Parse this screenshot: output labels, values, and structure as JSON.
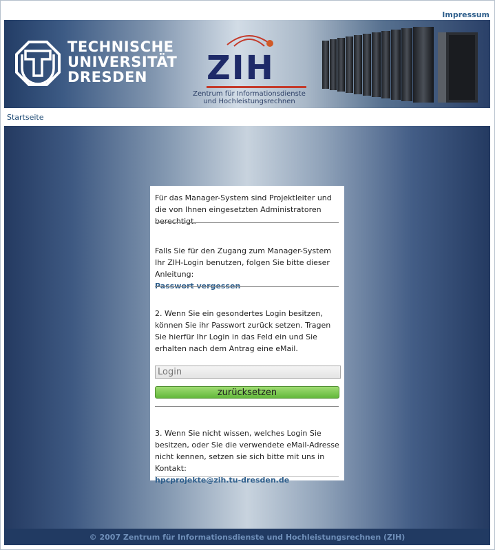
{
  "header": {
    "impressum": "Impressum"
  },
  "banner": {
    "university_lines": [
      "TECHNISCHE",
      "UNIVERSITÄT",
      "DRESDEN"
    ],
    "zih_word": "ZIH",
    "zih_subtitle_lines": [
      "Zentrum für Informationsdienste",
      "und Hochleistungsrechnen"
    ]
  },
  "nav": {
    "startseite": "Startseite"
  },
  "panel": {
    "intro": "Für das Manager-System sind Projektleiter und die von Ihnen eingesetzten Administratoren berechtigt.",
    "section1_text": "Falls Sie für den Zugang zum Manager-System Ihr ZIH-Login benutzen, folgen Sie bitte dieser Anleitung:",
    "section1_link": "Passwort vergessen",
    "section2_text": "2. Wenn Sie ein gesondertes Login besitzen, können Sie ihr Passwort zurück setzen. Tragen Sie hierfür Ihr Login in das Feld ein und Sie erhalten nach dem Antrag eine eMail.",
    "login_placeholder": "Login",
    "login_value": "",
    "submit_label": "zurücksetzen",
    "section3_text": "3. Wenn Sie nicht wissen, welches Login Sie besitzen, oder Sie die verwendete eMail-Adresse nicht kennen, setzen sie sich bitte mit uns in Kontakt:",
    "contact_email": "hpcprojekte@zih.tu-dresden.de"
  },
  "footer": {
    "text": "© 2007 Zentrum für Informationsdienste und Hochleistungsrechnen (ZIH)"
  },
  "colors": {
    "accent_link": "#2f5f8c",
    "button_green": "#63b83b",
    "footer_bg": "#213a62"
  }
}
